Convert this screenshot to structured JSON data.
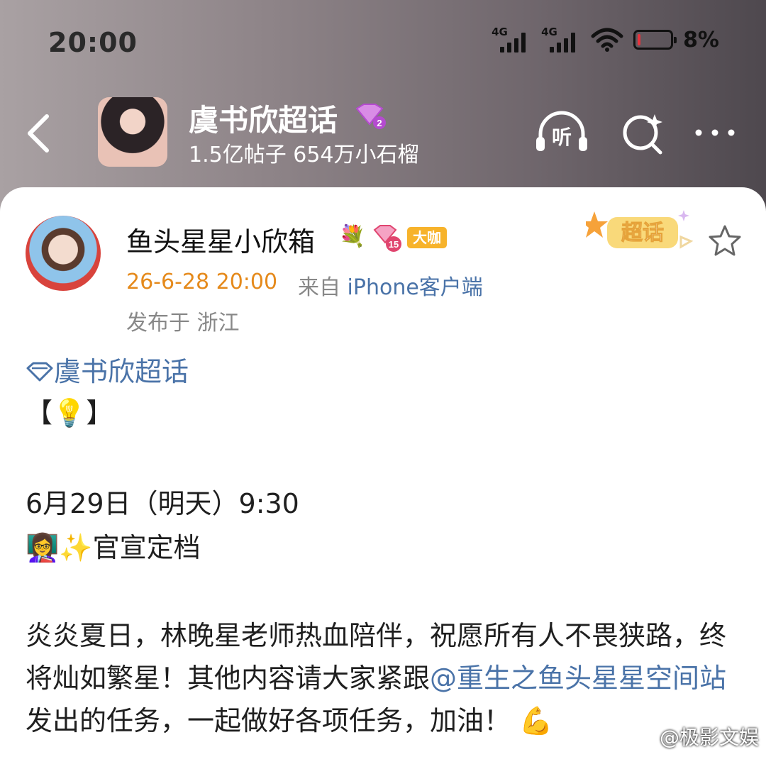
{
  "status_bar": {
    "time": "20:00",
    "signal_1": "4G",
    "signal_2": "4G",
    "battery_percent": "8%",
    "battery_level": 0.08,
    "battery_color": "#e8323c"
  },
  "header": {
    "topic_title": "虞书欣超话",
    "topic_badge_level": "2",
    "stats": "1.5亿帖子 654万小石榴",
    "listen_label": "听"
  },
  "post": {
    "username": "鱼头星星小欣箱",
    "flower_emoji": "💐",
    "level": "15",
    "vip_tag": "大咖",
    "time": "26-6-28 20:00",
    "source_prefix": "来自",
    "source_device": "iPhone客户端",
    "location": "发布于 浙江",
    "chaohua_badge": "超话",
    "topic_link": "虞书欣超话",
    "line_bracket": "【💡】",
    "line_date": "6月29日（明天）9:30",
    "line_announce": "👩‍🏫✨官宣定档",
    "body_part1": "炎炎夏日，林晚星老师热血陪伴，祝愿所有人不畏狭路，终将灿如繁星！其他内容请大家紧跟",
    "mention": "@重生之鱼头星星空间站",
    "body_part2": " 发出的任务，一起做好各项任务，加油！",
    "body_emoji": "💪"
  },
  "watermark": "@极影文娱",
  "colors": {
    "link": "#4a73a8",
    "time": "#e58a1c",
    "vip": "#f7b32b",
    "badge_purple": "#c04ad8"
  }
}
